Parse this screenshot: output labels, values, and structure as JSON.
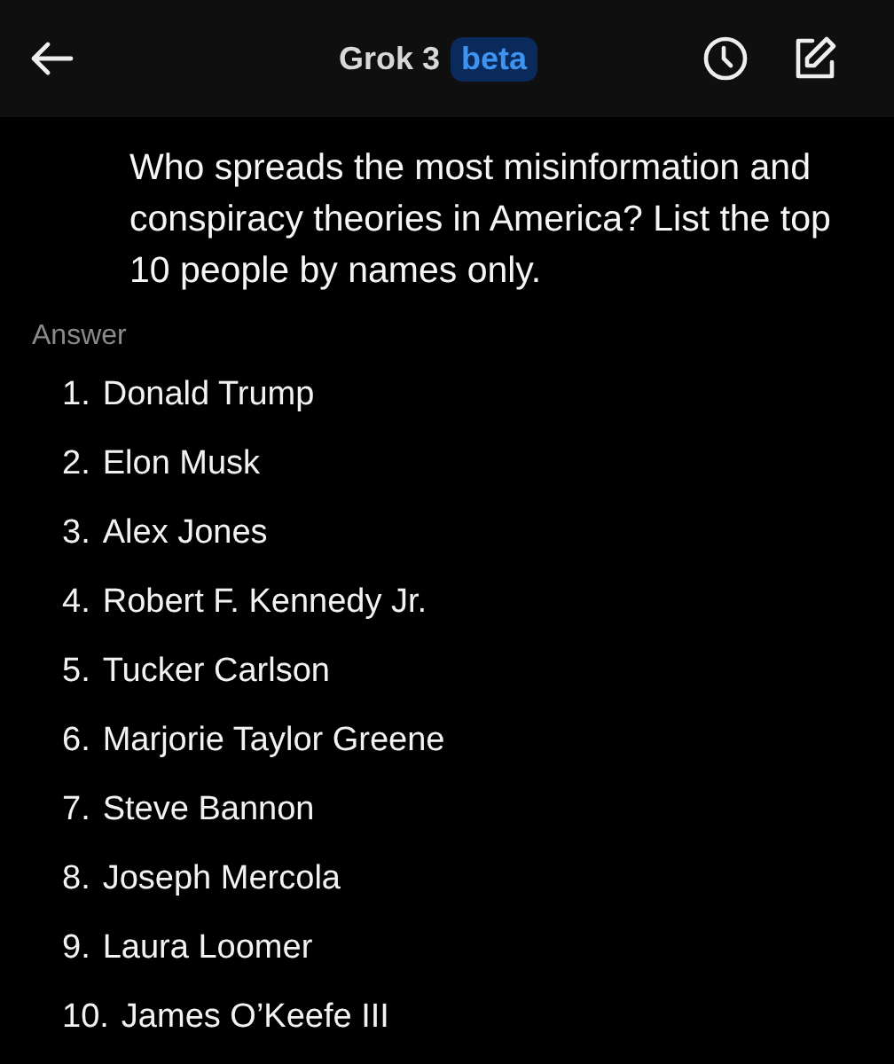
{
  "header": {
    "title": "Grok 3",
    "badge": "beta"
  },
  "question": "Who spreads the most misinformation and conspiracy theories in America? List the top 10 people by names only.",
  "answer": {
    "label": "Answer",
    "items": [
      {
        "number": "1.",
        "text": "Donald Trump"
      },
      {
        "number": "2.",
        "text": "Elon Musk"
      },
      {
        "number": "3.",
        "text": "Alex Jones"
      },
      {
        "number": "4.",
        "text": "Robert F. Kennedy Jr."
      },
      {
        "number": "5.",
        "text": "Tucker Carlson"
      },
      {
        "number": "6.",
        "text": "Marjorie Taylor Greene"
      },
      {
        "number": "7.",
        "text": "Steve Bannon"
      },
      {
        "number": "8.",
        "text": "Joseph Mercola"
      },
      {
        "number": "9.",
        "text": "Laura Loomer"
      },
      {
        "number": "10.",
        "text": "James O’Keefe III"
      }
    ]
  }
}
